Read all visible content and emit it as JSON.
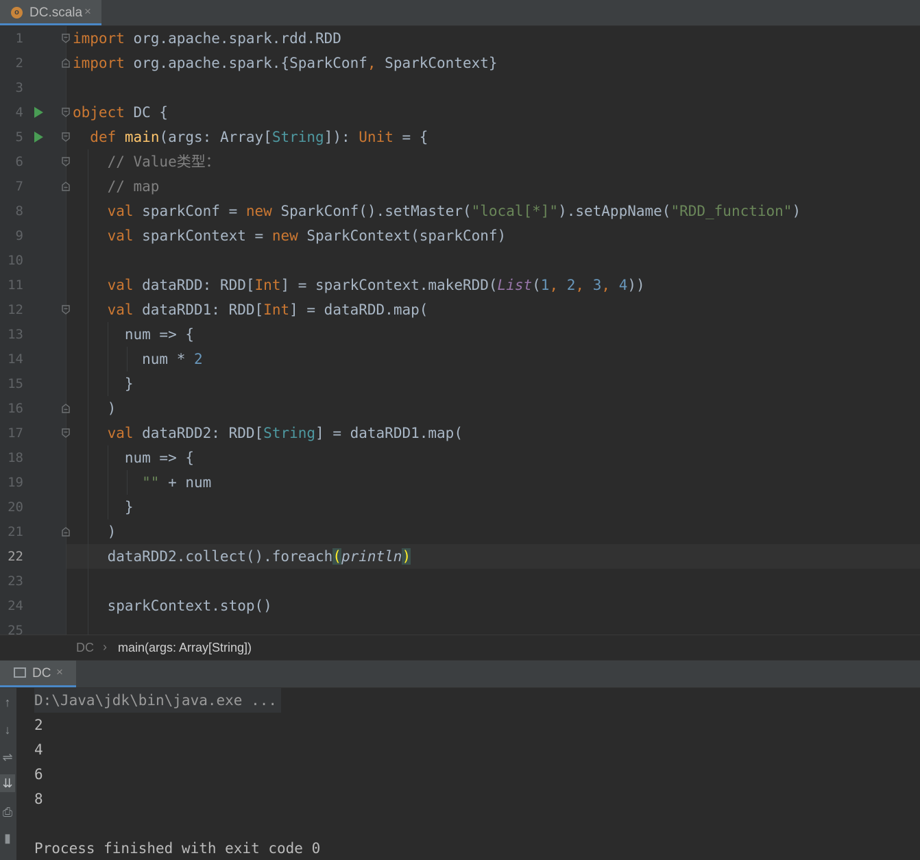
{
  "tab": {
    "icon": "scala-object-icon",
    "filename": "DC.scala",
    "close": "×"
  },
  "editor": {
    "line_numbers": [
      "1",
      "2",
      "3",
      "4",
      "5",
      "6",
      "7",
      "8",
      "9",
      "10",
      "11",
      "12",
      "13",
      "14",
      "15",
      "16",
      "17",
      "18",
      "19",
      "20",
      "21",
      "22",
      "23",
      "24",
      "25"
    ],
    "current_line": 22
  },
  "breadcrumbs": {
    "object": "DC",
    "separator": "›",
    "method": "main(args: Array[String])"
  },
  "run_panel": {
    "tab_label": "DC",
    "close": "×",
    "tools": [
      "up-arrow-icon",
      "down-arrow-icon",
      "soft-wrap-icon",
      "scroll-to-end-icon",
      "print-icon",
      "trash-icon"
    ],
    "command": "D:\\Java\\jdk\\bin\\java.exe ...",
    "output": [
      "2",
      "4",
      "6",
      "8"
    ],
    "finished": "Process finished with exit code 0"
  },
  "colors": {
    "keyword": "#cc7832",
    "string": "#6a8759",
    "number": "#6897bb",
    "type": "#4e98a0",
    "function": "#ffc66d",
    "comment": "#808080",
    "accent": "#4a88c7"
  }
}
